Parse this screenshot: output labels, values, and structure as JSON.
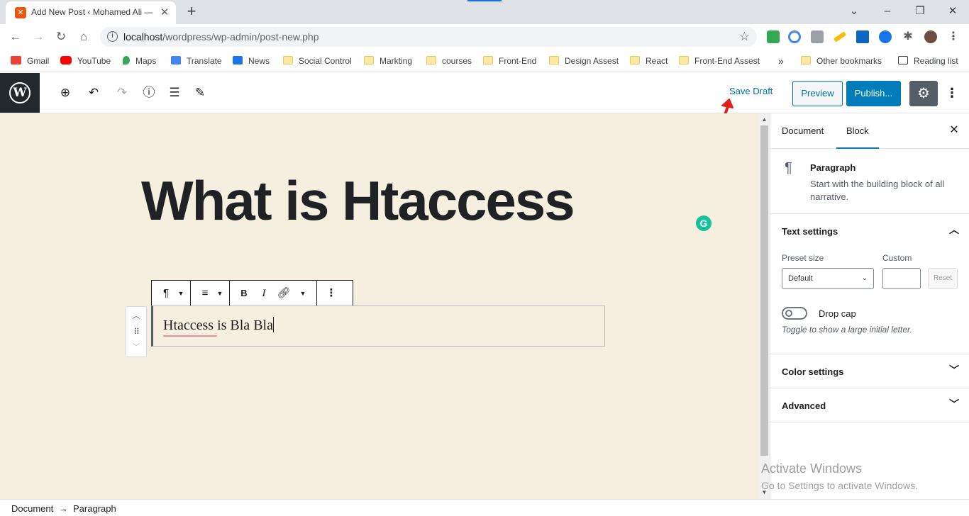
{
  "browser": {
    "tab_title": "Add New Post ‹ Mohamed Ali —",
    "url_host": "localhost",
    "url_path": "/wordpress/wp-admin/post-new.php",
    "bookmarks": [
      "Gmail",
      "YouTube",
      "Maps",
      "Translate",
      "News",
      "Social Control",
      "Markting",
      "courses",
      "Front-End",
      "Design Assest",
      "React",
      "Front-End Assest"
    ],
    "overflow": "»",
    "other_bookmarks": "Other bookmarks",
    "reading_list": "Reading list"
  },
  "wp_header": {
    "save_draft": "Save Draft",
    "preview": "Preview",
    "publish": "Publish..."
  },
  "editor": {
    "title": "What is Htaccess",
    "paragraph_text": "Htaccess is Bla Bla",
    "grammarly_badge": "G"
  },
  "sidebar": {
    "tabs": [
      "Document",
      "Block"
    ],
    "active_tab": "Block",
    "block_name": "Paragraph",
    "block_desc": "Start with the building block of all narrative.",
    "text_settings": {
      "title": "Text settings",
      "preset_label": "Preset size",
      "preset_value": "Default",
      "custom_label": "Custom",
      "reset": "Reset",
      "drop_cap": "Drop cap",
      "drop_cap_help": "Toggle to show a large initial letter."
    },
    "color_settings": "Color settings",
    "advanced": "Advanced"
  },
  "footer": {
    "crumbs": [
      "Document",
      "Paragraph"
    ],
    "sep": "→"
  },
  "watermark": {
    "line1": "Activate Windows",
    "line2": "Go to Settings to activate Windows."
  },
  "colors": {
    "wp_blue": "#007cba",
    "canvas_bg": "#f5efe0",
    "annotation_red": "#e0201c"
  }
}
